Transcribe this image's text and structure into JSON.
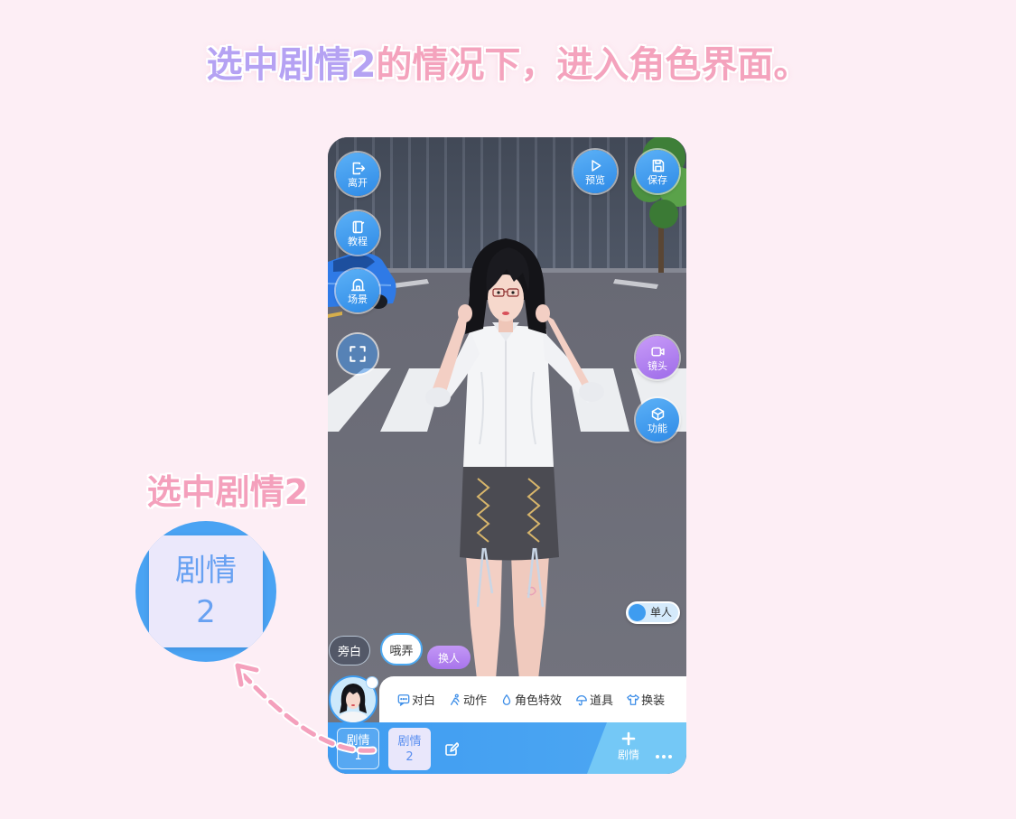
{
  "title": {
    "highlight": "选中剧情2",
    "rest": "的情况下，进入角色界面。"
  },
  "callout": {
    "label": "选中剧情2",
    "zoom_card": {
      "line1": "剧情",
      "line2": "2"
    }
  },
  "phone": {
    "left_buttons": [
      {
        "label": "离开",
        "icon": "exit-icon"
      },
      {
        "label": "教程",
        "icon": "tutorial-book-icon"
      },
      {
        "label": "场景",
        "icon": "scene-icon"
      },
      {
        "icon": "fullscreen-icon"
      }
    ],
    "top_right_buttons": [
      {
        "label": "预览",
        "icon": "play-icon"
      },
      {
        "label": "保存",
        "icon": "save-icon"
      }
    ],
    "right_buttons": [
      {
        "label": "镜头",
        "icon": "camera-icon",
        "color": "#b07ef0"
      },
      {
        "label": "功能",
        "icon": "function-cube-icon",
        "color": "#3e9cf0"
      }
    ],
    "mode_toggle": {
      "label": "单人"
    },
    "chips": [
      {
        "label": "旁白"
      },
      {
        "label": "哦弄",
        "selected": true
      },
      {
        "label": "换人"
      }
    ],
    "action_toolbar": [
      {
        "label": "对白",
        "icon": "dialogue-icon"
      },
      {
        "label": "动作",
        "icon": "action-icon"
      },
      {
        "label": "角色特效",
        "icon": "effect-icon"
      },
      {
        "label": "道具",
        "icon": "prop-icon"
      },
      {
        "label": "换装",
        "icon": "outfit-icon"
      }
    ],
    "plot_bar": {
      "cards": [
        {
          "line1": "剧情",
          "line2": "1"
        },
        {
          "line1": "剧情",
          "line2": "2",
          "selected": true
        }
      ],
      "edit_icon": "edit-icon",
      "add_icon": "plus-icon",
      "add_label": "剧情",
      "more_icon": "more-icon"
    }
  },
  "colors": {
    "background": "#fdeef5",
    "title_pink": "#f4a3bd",
    "title_lavender": "#b5a2f3",
    "accent_blue": "#3e9cf0",
    "purple": "#b07ef0",
    "selected_card": "#e9e7fb"
  }
}
